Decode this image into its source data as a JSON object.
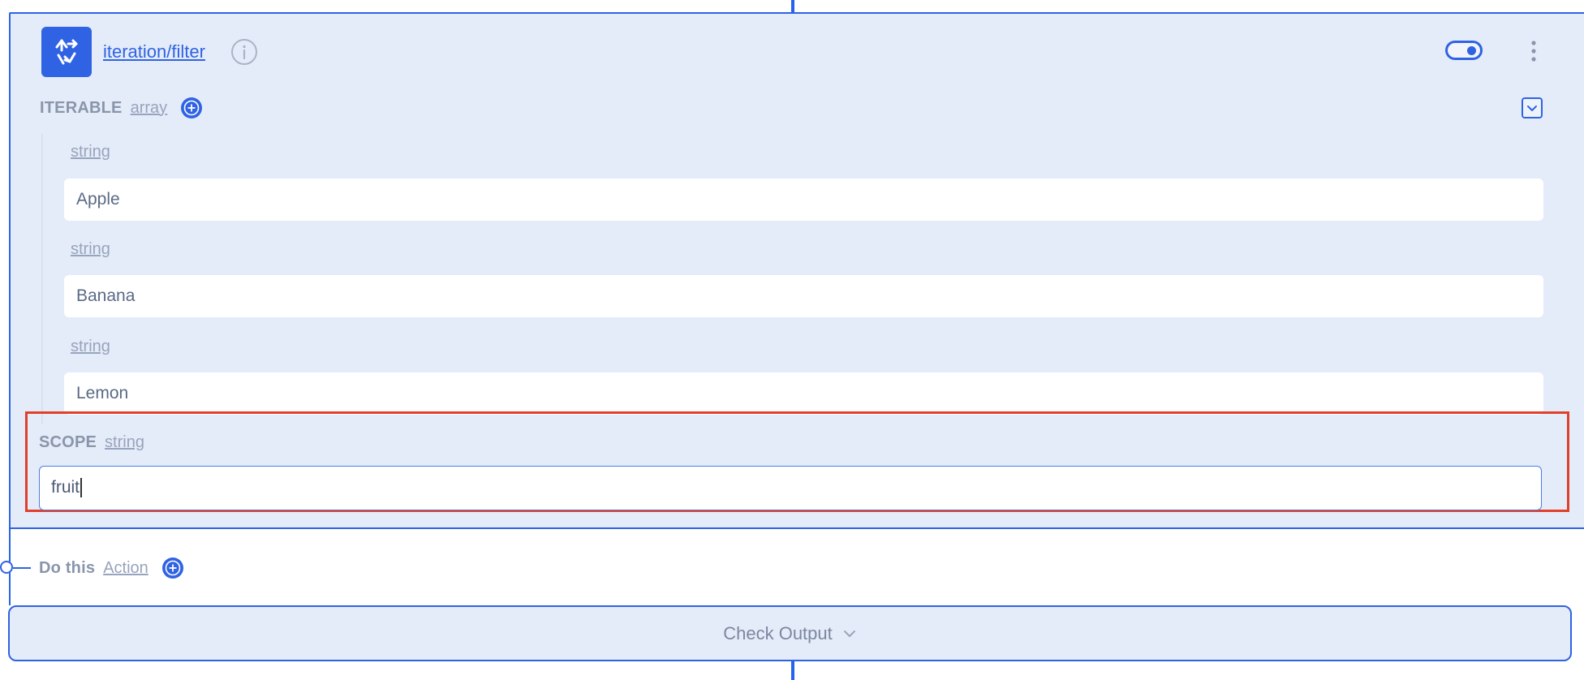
{
  "node": {
    "title": "iteration/filter",
    "toggle_on": true
  },
  "iterable": {
    "label": "ITERABLE",
    "type": "array",
    "items": [
      {
        "type": "string",
        "value": "Apple"
      },
      {
        "type": "string",
        "value": "Banana"
      },
      {
        "type": "string",
        "value": "Lemon"
      }
    ]
  },
  "scope": {
    "label": "SCOPE",
    "type": "string",
    "value": "fruit"
  },
  "do_this": {
    "label": "Do this",
    "type": "Action"
  },
  "check_output": {
    "label": "Check Output"
  },
  "colors": {
    "accent": "#2f63e3",
    "card_bg": "#e5ecf9",
    "highlight": "#e0402a"
  },
  "icons": [
    "workflow-icon",
    "info-icon",
    "toggle-switch",
    "more-vertical-icon",
    "plus-circle-icon",
    "collapse-icon",
    "chevron-down-icon"
  ]
}
